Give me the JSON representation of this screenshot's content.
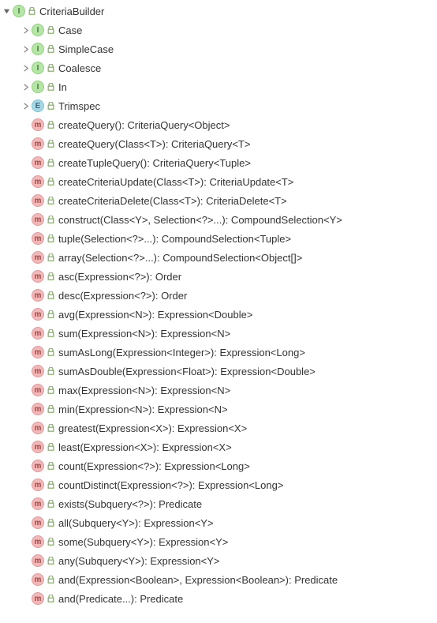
{
  "root": {
    "badge": "I",
    "label": "CriteriaBuilder",
    "expanded": true
  },
  "types": [
    {
      "badge": "I",
      "label": "Case",
      "expanded": false
    },
    {
      "badge": "I",
      "label": "SimpleCase",
      "expanded": false
    },
    {
      "badge": "I",
      "label": "Coalesce",
      "expanded": false
    },
    {
      "badge": "I",
      "label": "In",
      "expanded": false
    },
    {
      "badge": "E",
      "label": "Trimspec",
      "expanded": false
    }
  ],
  "methods": [
    {
      "label": "createQuery(): CriteriaQuery<Object>"
    },
    {
      "label": "createQuery(Class<T>): CriteriaQuery<T>"
    },
    {
      "label": "createTupleQuery(): CriteriaQuery<Tuple>"
    },
    {
      "label": "createCriteriaUpdate(Class<T>): CriteriaUpdate<T>"
    },
    {
      "label": "createCriteriaDelete(Class<T>): CriteriaDelete<T>"
    },
    {
      "label": "construct(Class<Y>, Selection<?>...): CompoundSelection<Y>"
    },
    {
      "label": "tuple(Selection<?>...): CompoundSelection<Tuple>"
    },
    {
      "label": "array(Selection<?>...): CompoundSelection<Object[]>"
    },
    {
      "label": "asc(Expression<?>): Order"
    },
    {
      "label": "desc(Expression<?>): Order"
    },
    {
      "label": "avg(Expression<N>): Expression<Double>"
    },
    {
      "label": "sum(Expression<N>): Expression<N>"
    },
    {
      "label": "sumAsLong(Expression<Integer>): Expression<Long>"
    },
    {
      "label": "sumAsDouble(Expression<Float>): Expression<Double>"
    },
    {
      "label": "max(Expression<N>): Expression<N>"
    },
    {
      "label": "min(Expression<N>): Expression<N>"
    },
    {
      "label": "greatest(Expression<X>): Expression<X>"
    },
    {
      "label": "least(Expression<X>): Expression<X>"
    },
    {
      "label": "count(Expression<?>): Expression<Long>"
    },
    {
      "label": "countDistinct(Expression<?>): Expression<Long>"
    },
    {
      "label": "exists(Subquery<?>): Predicate"
    },
    {
      "label": "all(Subquery<Y>): Expression<Y>"
    },
    {
      "label": "some(Subquery<Y>): Expression<Y>"
    },
    {
      "label": "any(Subquery<Y>): Expression<Y>"
    },
    {
      "label": "and(Expression<Boolean>, Expression<Boolean>): Predicate"
    },
    {
      "label": "and(Predicate...): Predicate"
    }
  ]
}
